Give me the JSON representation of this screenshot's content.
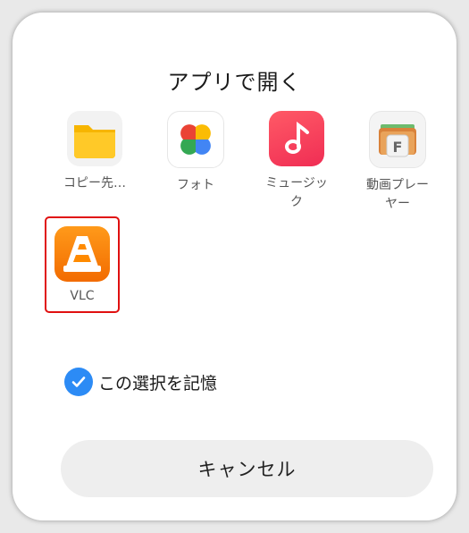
{
  "dialog": {
    "title": "アプリで開く",
    "apps": [
      {
        "label": "コピー先…",
        "icon": "folder-icon"
      },
      {
        "label": "フォト",
        "icon": "photos-pinwheel-icon"
      },
      {
        "label": "ミュージック",
        "icon": "music-note-icon"
      },
      {
        "label": "動画プレーヤー",
        "icon": "video-player-icon"
      },
      {
        "label": "VLC",
        "icon": "vlc-cone-icon"
      }
    ],
    "remember_label": "この選択を記憶",
    "remember_checked": true,
    "cancel_label": "キャンセル"
  }
}
